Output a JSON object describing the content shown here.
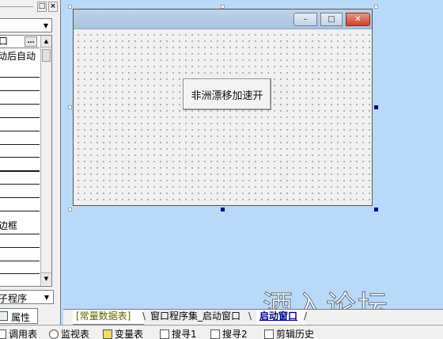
{
  "panel": {
    "max_icon": "□",
    "close_icon": "×",
    "object_select_value": "",
    "property_rows": [
      {
        "text": "口",
        "button": "…"
      },
      {
        "text": "动后自动"
      }
    ],
    "border_row_text": "边框",
    "event_select_value": "子程序",
    "dropdown_arrow": "▼",
    "scroll_up": "▲",
    "scroll_down": "▼",
    "tab_label": "属性"
  },
  "form": {
    "min_glyph": "–",
    "max_glyph": "□",
    "close_glyph": "✕",
    "button_label": "非洲漂移加速开"
  },
  "design_tabs": [
    {
      "label": "[常量数据表]",
      "active": false
    },
    {
      "label": "窗口程序集_启动窗口",
      "active": false
    },
    {
      "label": "启动窗口",
      "active": true
    }
  ],
  "bottom_bar": [
    {
      "label": "调用表",
      "icon": "call-table-icon"
    },
    {
      "label": "监视表",
      "icon": "watch-icon"
    },
    {
      "label": "变量表",
      "icon": "variable-icon"
    },
    {
      "label": "搜寻1",
      "icon": "search1-icon"
    },
    {
      "label": "搜寻2",
      "icon": "search2-icon"
    },
    {
      "label": "剪辑历史",
      "icon": "clip-history-icon"
    }
  ],
  "watermark": "酒入论坛",
  "colors": {
    "design_background": "#b9d9fb",
    "close_button": "#c8432b",
    "selection_handle": "#00008b"
  }
}
